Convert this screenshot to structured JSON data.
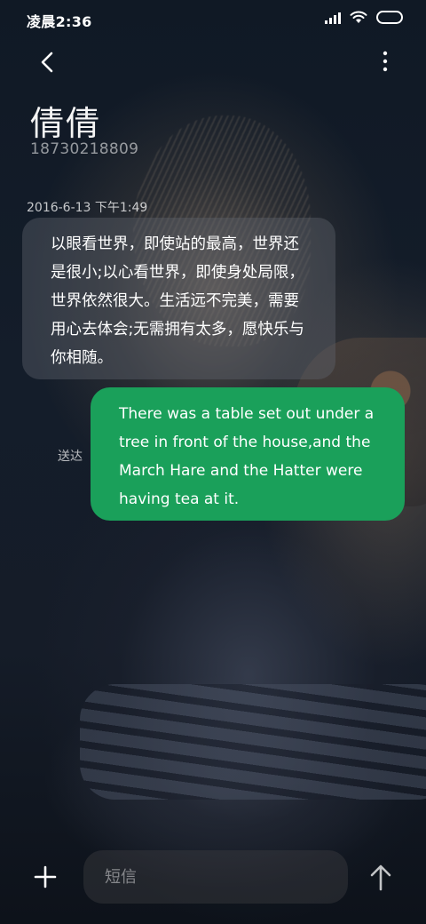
{
  "status_bar": {
    "time": "凌晨2:36",
    "icons": [
      "signal-icon",
      "wifi-icon",
      "battery-icon"
    ]
  },
  "header": {
    "back_icon": "back-arrow-icon",
    "more_icon": "more-vertical-icon",
    "contact_name": "倩倩",
    "contact_number": "18730218809"
  },
  "conversation": {
    "timestamp": "2016-6-13 下午1:49",
    "messages": [
      {
        "direction": "incoming",
        "text": "以眼看世界，即使站的最高，世界还是很小;以心看世界，即使身处局限，世界依然很大。生活远不完美，需要用心去体会;无需拥有太多，愿快乐与你相随。"
      },
      {
        "direction": "outgoing",
        "text": "There was a table set out under a tree in front of the house,and the March Hare and the Hatter were having tea at it.",
        "status": "送达"
      }
    ]
  },
  "composer": {
    "add_icon": "plus-icon",
    "placeholder": "短信",
    "value": "",
    "send_icon": "send-arrow-icon"
  },
  "colors": {
    "outgoing_bubble": "#1aa05a",
    "incoming_bubble": "rgba(95,100,110,0.42)",
    "background": "#141d2a"
  }
}
